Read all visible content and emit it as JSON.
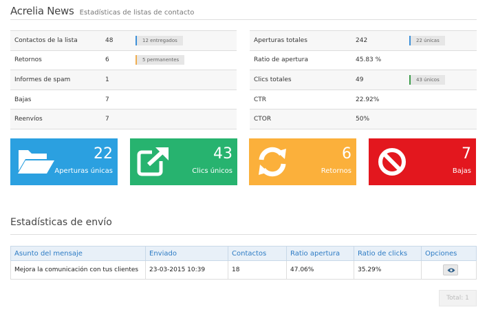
{
  "header": {
    "title": "Acrelia News",
    "subtitle": "Estadísticas de listas de contacto"
  },
  "stats_left": [
    {
      "label": "Contactos de la lista",
      "value": "48",
      "badge": "12 entregados",
      "badge_color": "#3b8fd9"
    },
    {
      "label": "Retornos",
      "value": "6",
      "badge": "5 permanentes",
      "badge_color": "#f0ad4e"
    },
    {
      "label": "Informes de spam",
      "value": "1",
      "badge": ""
    },
    {
      "label": "Bajas",
      "value": "7",
      "badge": ""
    },
    {
      "label": "Reenvíos",
      "value": "7",
      "badge": ""
    }
  ],
  "stats_right": [
    {
      "label": "Aperturas totales",
      "value": "242",
      "badge": "22 únicas",
      "badge_color": "#3b8fd9"
    },
    {
      "label": "Ratio de apertura",
      "value": "45.83 %",
      "badge": ""
    },
    {
      "label": "Clics totales",
      "value": "49",
      "badge": "43 únicos",
      "badge_color": "#3c9c4a"
    },
    {
      "label": "CTR",
      "value": "22.92%",
      "badge": ""
    },
    {
      "label": "CTOR",
      "value": "50%",
      "badge": ""
    }
  ],
  "tiles": {
    "aperturas": {
      "number": "22",
      "label": "Aperturas únicas",
      "icon": "folder-open-icon",
      "color": "#2ba0e0"
    },
    "clics": {
      "number": "43",
      "label": "Clics únicos",
      "icon": "external-link-icon",
      "color": "#27b36f"
    },
    "retornos": {
      "number": "6",
      "label": "Retornos",
      "icon": "refresh-icon",
      "color": "#fbb03b"
    },
    "bajas": {
      "number": "7",
      "label": "Bajas",
      "icon": "ban-icon",
      "color": "#e3171e"
    }
  },
  "sends": {
    "title": "Estadísticas de envío",
    "columns": [
      "Asunto del mensaje",
      "Enviado",
      "Contactos",
      "Ratio apertura",
      "Ratio de clicks",
      "Opciones"
    ],
    "rows": [
      {
        "subject": "Mejora la comunicación con tus clientes",
        "sent": "23-03-2015 10:39",
        "contacts": "18",
        "open_rate": "47.06%",
        "click_rate": "35.29%",
        "option_icon": "eye-icon"
      }
    ],
    "total": "Total: 1"
  }
}
